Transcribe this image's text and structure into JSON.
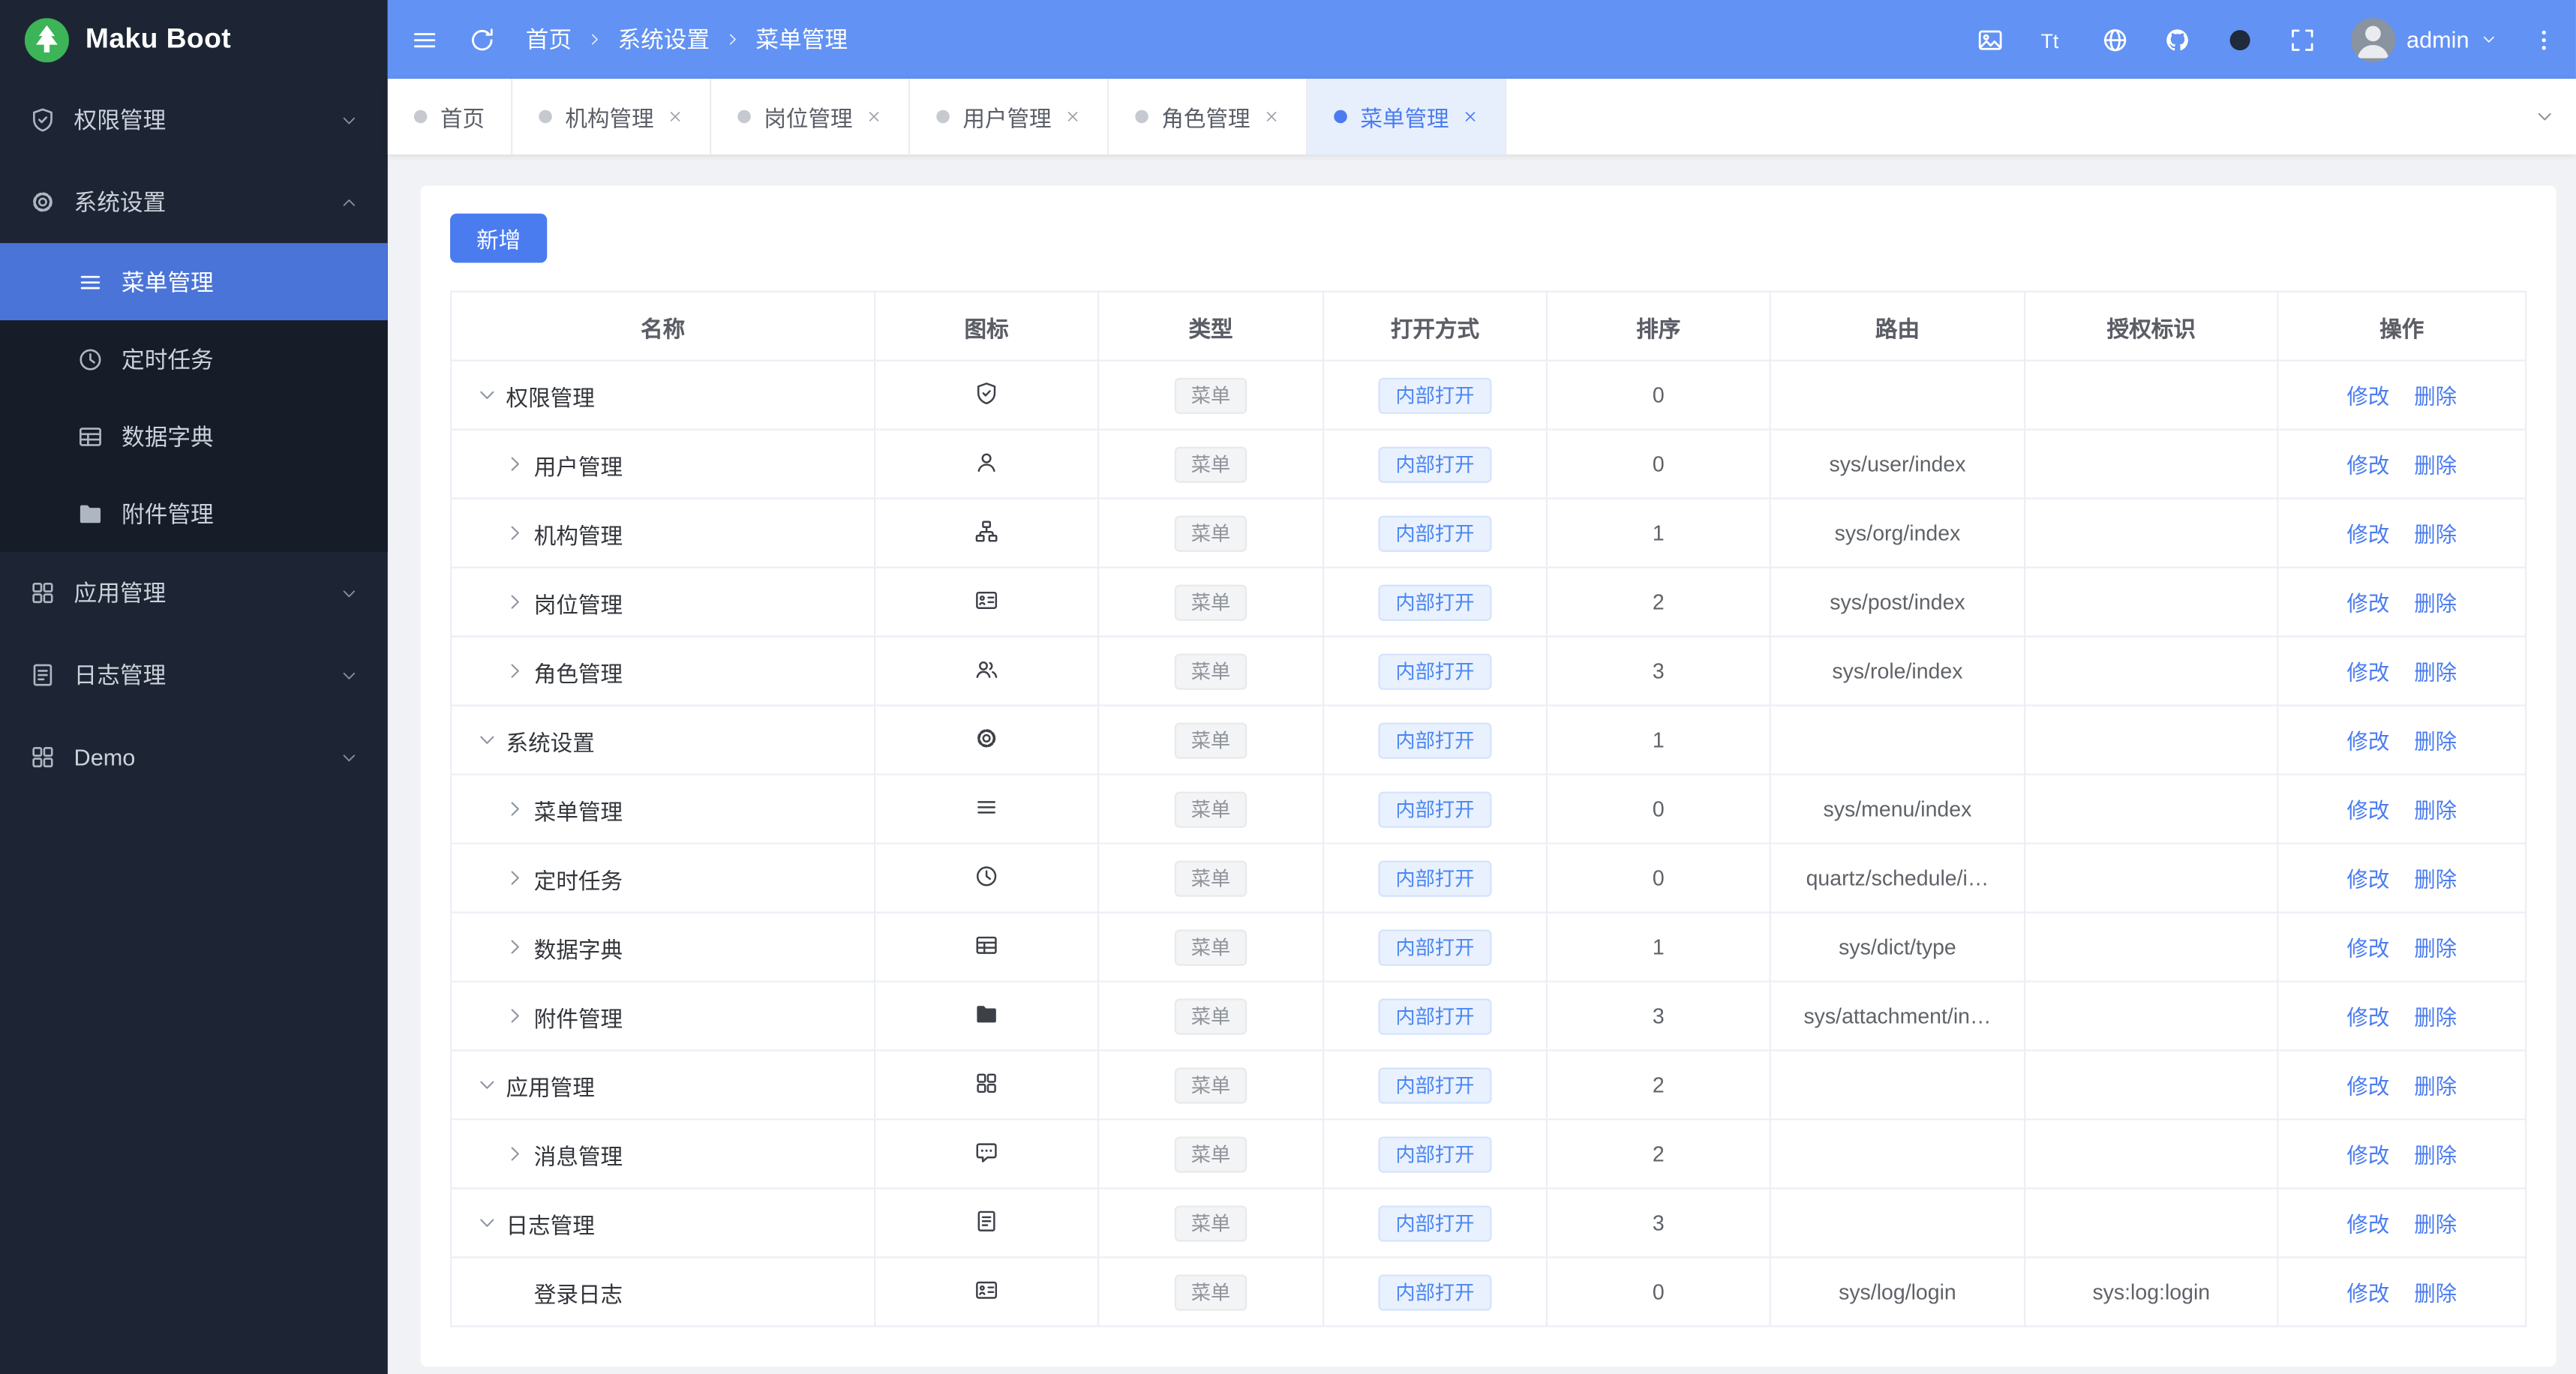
{
  "brand": {
    "name": "Maku Boot"
  },
  "topbar": {
    "left_icons": [
      "hamburger",
      "refresh"
    ],
    "breadcrumb": [
      "首页",
      "系统设置",
      "菜单管理"
    ],
    "right_icons": [
      "image",
      "font-size",
      "globe",
      "github",
      "theme",
      "fullscreen"
    ],
    "username": "admin"
  },
  "sidebar": {
    "items": [
      {
        "label": "权限管理",
        "icon": "shield",
        "state": "collapsed"
      },
      {
        "label": "系统设置",
        "icon": "gear",
        "state": "expanded",
        "children": [
          {
            "label": "菜单管理",
            "icon": "menu-lines",
            "selected": true
          },
          {
            "label": "定时任务",
            "icon": "clock",
            "selected": false
          },
          {
            "label": "数据字典",
            "icon": "table",
            "selected": false
          },
          {
            "label": "附件管理",
            "icon": "folder",
            "selected": false
          }
        ]
      },
      {
        "label": "应用管理",
        "icon": "grid",
        "state": "collapsed"
      },
      {
        "label": "日志管理",
        "icon": "doc",
        "state": "collapsed"
      },
      {
        "label": "Demo",
        "icon": "grid",
        "state": "collapsed"
      }
    ]
  },
  "tabbar": {
    "tabs": [
      {
        "label": "首页",
        "closable": false,
        "active": false
      },
      {
        "label": "机构管理",
        "closable": true,
        "active": false
      },
      {
        "label": "岗位管理",
        "closable": true,
        "active": false
      },
      {
        "label": "用户管理",
        "closable": true,
        "active": false
      },
      {
        "label": "角色管理",
        "closable": true,
        "active": false
      },
      {
        "label": "菜单管理",
        "closable": true,
        "active": true
      }
    ]
  },
  "toolbar": {
    "add_label": "新增"
  },
  "table": {
    "headers": [
      "名称",
      "图标",
      "类型",
      "打开方式",
      "排序",
      "路由",
      "授权标识",
      "操作"
    ],
    "action_labels": [
      "修改",
      "删除"
    ],
    "rows": [
      {
        "name": "权限管理",
        "icon": "shield",
        "type": "菜单",
        "open": "内部打开",
        "sort": "0",
        "route": "",
        "auth": "",
        "level": 0,
        "expand": "open"
      },
      {
        "name": "用户管理",
        "icon": "user",
        "type": "菜单",
        "open": "内部打开",
        "sort": "0",
        "route": "sys/user/index",
        "auth": "",
        "level": 1,
        "expand": "closed"
      },
      {
        "name": "机构管理",
        "icon": "org",
        "type": "菜单",
        "open": "内部打开",
        "sort": "1",
        "route": "sys/org/index",
        "auth": "",
        "level": 1,
        "expand": "closed"
      },
      {
        "name": "岗位管理",
        "icon": "postcard",
        "type": "菜单",
        "open": "内部打开",
        "sort": "2",
        "route": "sys/post/index",
        "auth": "",
        "level": 1,
        "expand": "closed"
      },
      {
        "name": "角色管理",
        "icon": "users",
        "type": "菜单",
        "open": "内部打开",
        "sort": "3",
        "route": "sys/role/index",
        "auth": "",
        "level": 1,
        "expand": "closed"
      },
      {
        "name": "系统设置",
        "icon": "gear",
        "type": "菜单",
        "open": "内部打开",
        "sort": "1",
        "route": "",
        "auth": "",
        "level": 0,
        "expand": "open"
      },
      {
        "name": "菜单管理",
        "icon": "menu-lines",
        "type": "菜单",
        "open": "内部打开",
        "sort": "0",
        "route": "sys/menu/index",
        "auth": "",
        "level": 1,
        "expand": "closed"
      },
      {
        "name": "定时任务",
        "icon": "clock",
        "type": "菜单",
        "open": "内部打开",
        "sort": "0",
        "route": "quartz/schedule/i…",
        "auth": "",
        "level": 1,
        "expand": "closed"
      },
      {
        "name": "数据字典",
        "icon": "table",
        "type": "菜单",
        "open": "内部打开",
        "sort": "1",
        "route": "sys/dict/type",
        "auth": "",
        "level": 1,
        "expand": "closed"
      },
      {
        "name": "附件管理",
        "icon": "folder",
        "type": "菜单",
        "open": "内部打开",
        "sort": "3",
        "route": "sys/attachment/in…",
        "auth": "",
        "level": 1,
        "expand": "closed"
      },
      {
        "name": "应用管理",
        "icon": "grid",
        "type": "菜单",
        "open": "内部打开",
        "sort": "2",
        "route": "",
        "auth": "",
        "level": 0,
        "expand": "open"
      },
      {
        "name": "消息管理",
        "icon": "message",
        "type": "菜单",
        "open": "内部打开",
        "sort": "2",
        "route": "",
        "auth": "",
        "level": 1,
        "expand": "closed"
      },
      {
        "name": "日志管理",
        "icon": "doc",
        "type": "菜单",
        "open": "内部打开",
        "sort": "3",
        "route": "",
        "auth": "",
        "level": 0,
        "expand": "open"
      },
      {
        "name": "登录日志",
        "icon": "postcard",
        "type": "菜单",
        "open": "内部打开",
        "sort": "0",
        "route": "sys/log/login",
        "auth": "sys:log:login",
        "level": 1,
        "expand": "none"
      }
    ]
  },
  "colors": {
    "primary": "#4a7cf0",
    "topbar_bg": "#6292f3",
    "sidebar_bg": "#1d2534",
    "sidebar_selected_bg": "#4a74d8",
    "active_tab_bg": "#e7effd",
    "logo_green": "#3cb457"
  }
}
